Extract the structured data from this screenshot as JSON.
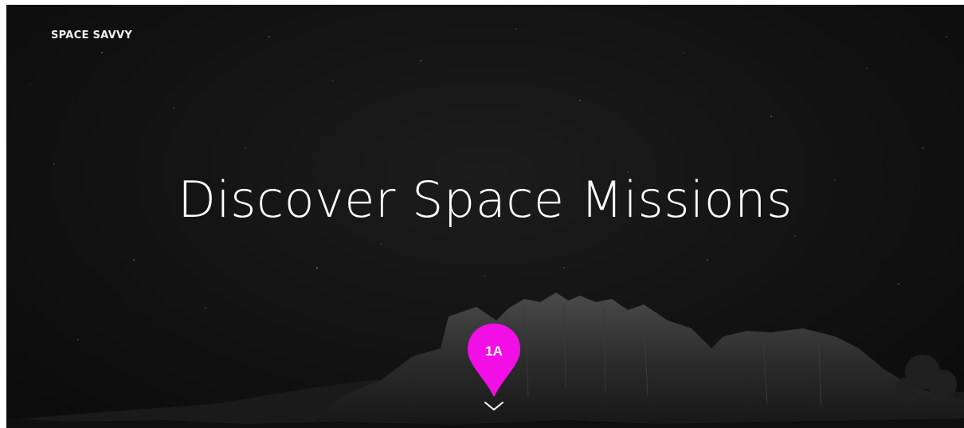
{
  "header": {
    "brand": "SPACE SAVVY"
  },
  "hero": {
    "title": "Discover Space Missions"
  },
  "marker": {
    "label": "1A",
    "color": "#f20fe6"
  },
  "icons": {
    "scroll": "chevron-down-icon"
  }
}
